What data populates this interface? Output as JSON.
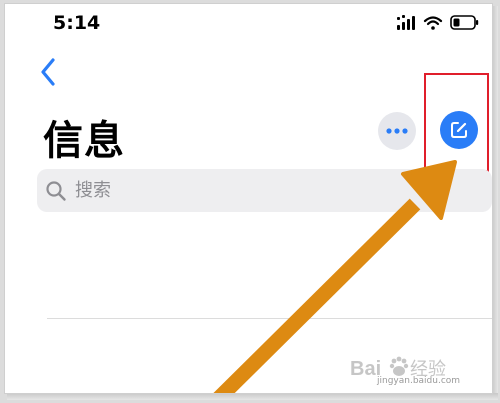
{
  "status_bar": {
    "time": "5:14"
  },
  "header": {
    "title": "信息"
  },
  "search": {
    "placeholder": "搜索"
  },
  "colors": {
    "accent": "#2a7df7",
    "highlight": "#e01e2b",
    "arrow": "#dd8a12"
  },
  "icons": {
    "back": "chevron-left-icon",
    "more": "ellipsis-icon",
    "compose": "compose-icon",
    "search": "search-icon"
  },
  "watermark": {
    "url": "jingyan.baidu.com"
  }
}
